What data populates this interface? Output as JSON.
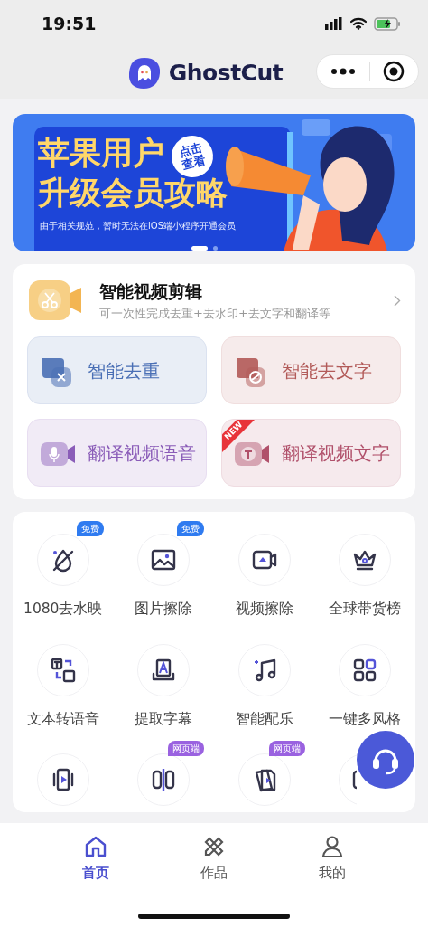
{
  "status_bar": {
    "time": "19:51"
  },
  "nav": {
    "title": "GhostCut"
  },
  "banner": {
    "title_lines": [
      "苹果用户",
      "升级会员攻略"
    ],
    "badge_lines": [
      "点击",
      "查看"
    ],
    "subtitle": "由于相关规范，暂时无法在iOS端小程序开通会员",
    "dots": [
      {
        "selected": true
      },
      {
        "selected": false
      }
    ]
  },
  "feature": {
    "title": "智能视频剪辑",
    "subtitle": "可一次性完成去重+去水印+去文字和翻译等"
  },
  "quick_tools": [
    {
      "label": "智能去重",
      "color": "#4a6fb5"
    },
    {
      "label": "智能去文字",
      "color": "#b25a58"
    },
    {
      "label": "翻译视频语音",
      "color": "#8a5cb8"
    },
    {
      "label": "翻译视频文字",
      "color": "#b0506a",
      "badge": "NEW"
    }
  ],
  "tools": [
    {
      "label": "1080去水映",
      "badge": {
        "text": "免费",
        "color": "#2f7bf0"
      }
    },
    {
      "label": "图片擦除",
      "badge": {
        "text": "免费",
        "color": "#2f7bf0"
      }
    },
    {
      "label": "视频擦除"
    },
    {
      "label": "全球带货榜"
    },
    {
      "label": "文本转语音"
    },
    {
      "label": "提取字幕"
    },
    {
      "label": "智能配乐"
    },
    {
      "label": "一键多风格"
    },
    {
      "kind": "cut"
    },
    {
      "kind": "cut",
      "badge": {
        "text": "网页端",
        "color": "#9a62e0"
      }
    },
    {
      "kind": "cut",
      "badge": {
        "text": "网页端",
        "color": "#9a62e0"
      }
    },
    {
      "kind": "cut"
    }
  ],
  "tab_bar": [
    {
      "label": "首页",
      "selected": true
    },
    {
      "label": "作品",
      "selected": false
    },
    {
      "label": "我的",
      "selected": false
    }
  ]
}
